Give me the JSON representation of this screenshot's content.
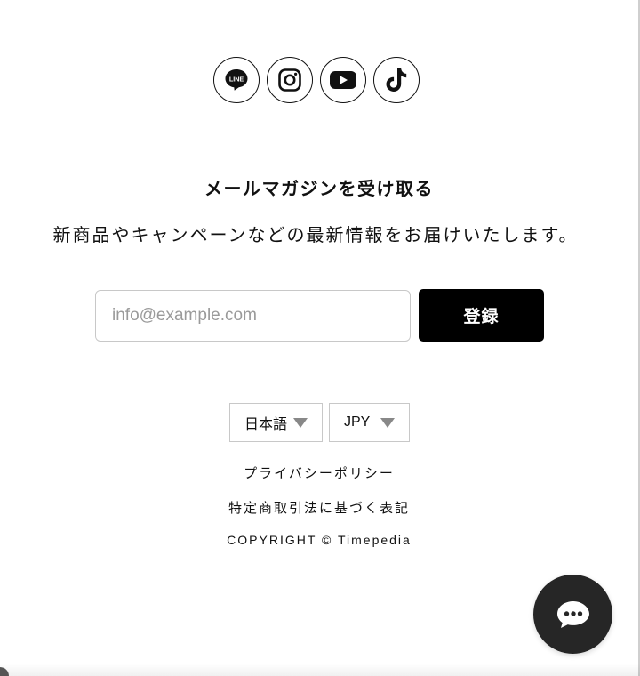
{
  "social": {
    "line_label": "LINE",
    "icons": [
      "line-icon",
      "instagram-icon",
      "youtube-icon",
      "tiktok-icon"
    ]
  },
  "newsletter": {
    "title": "メールマガジンを受け取る",
    "description": "新商品やキャンペーンなどの最新情報をお届けいたします。",
    "email_placeholder": "info@example.com",
    "submit_label": "登録"
  },
  "locale": {
    "language": "日本語",
    "currency": "JPY"
  },
  "footer": {
    "privacy_link": "プライバシーポリシー",
    "legal_link": "特定商取引法に基づく表記",
    "copyright": "COPYRIGHT © Timepedia"
  },
  "colors": {
    "accent": "#000000",
    "chat_button": "#262626",
    "border": "#c8c8c8"
  }
}
